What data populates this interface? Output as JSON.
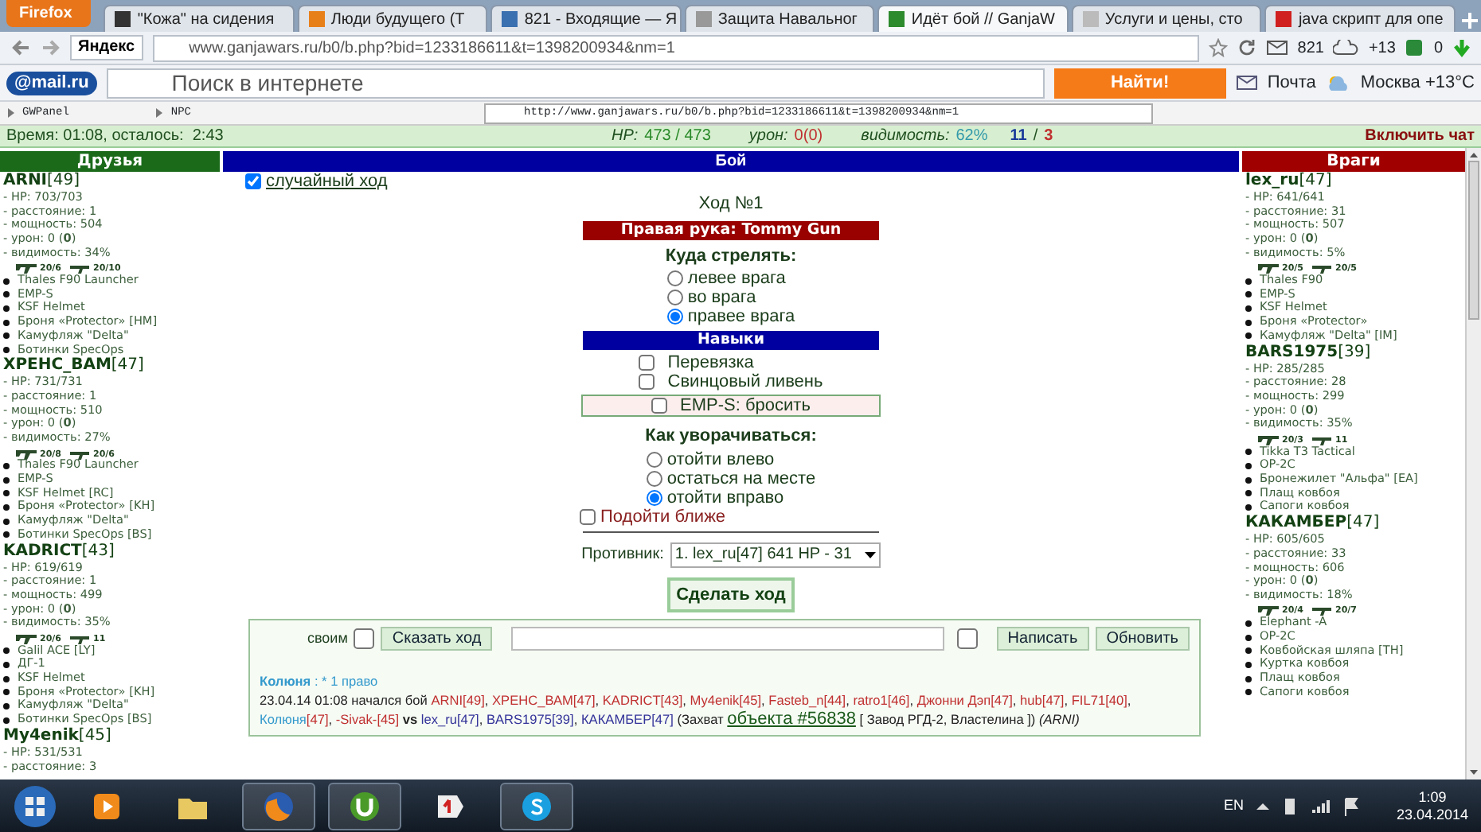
{
  "browser": {
    "menu_button": "Firefox",
    "tabs": [
      {
        "title": "\"Кожа\" на сидения",
        "selected": false,
        "color": "#333333"
      },
      {
        "title": "Люди будущего (Т",
        "selected": false,
        "color": "#e8801a"
      },
      {
        "title": "821 - Входящие — Я",
        "selected": false,
        "color": "#3a6fb0"
      },
      {
        "title": "Защита Навальног",
        "selected": false,
        "color": "#999999"
      },
      {
        "title": "Идёт бой // GanjaW",
        "selected": true,
        "color": "#2d8a2d"
      },
      {
        "title": "Услуги и цены, сто",
        "selected": false,
        "color": "#bbbbbb"
      },
      {
        "title": "java скрипт для опе",
        "selected": false,
        "color": "#d02020"
      }
    ],
    "search_engine": "Яндекс",
    "address": "www.ganjawars.ru/b0/b.php?bid=1233186611&t=1398200934&nm=1",
    "mail_count": "821",
    "weather_temp": "+13",
    "counter": "0"
  },
  "mailru_bar": {
    "logo": "@mail.ru",
    "placeholder": "Поиск в интернете",
    "search_button": "Найти!",
    "mail": "Почта",
    "weather": "Москва +13°C"
  },
  "ext_bar": {
    "items": [
      "GWPanel",
      "NPC"
    ],
    "url": "http://www.ganjawars.ru/b0/b.php?bid=1233186611&t=1398200934&nm=1"
  },
  "status": {
    "time": "Время: 01:08, осталось:  2:43",
    "hp_label": "HP:",
    "hp": "473 / 473",
    "damage_label": "урон:",
    "damage": "0(0)",
    "visibility_label": "видимость:",
    "visibility": "62%",
    "friends_count": "11",
    "separator": "/",
    "enemies_count": "3",
    "chat_button": "Включить чат"
  },
  "friends": {
    "title": "Друзья",
    "players": [
      {
        "name": "ARNI",
        "level": "[49]",
        "stats": [
          "- HP: 703/703",
          "- расстояние: 1",
          "- мощность: 504",
          "- урон: 0 (**0**)",
          "- видимость: 34%"
        ],
        "weapons": [
          "20/6",
          "20/10"
        ],
        "items": [
          "Thales F90 Launcher",
          "EMP-S",
          "KSF Helmet",
          "Броня «Protector» [HM]",
          "Камуфляж \"Delta\"",
          "Ботинки SpecOps"
        ]
      },
      {
        "name": "ХРЕНС_ВАМ",
        "level": "[47]",
        "stats": [
          "- HP: 731/731",
          "- расстояние: 1",
          "- мощность: 510",
          "- урон: 0 (**0**)",
          "- видимость: 27%"
        ],
        "weapons": [
          "20/8",
          "20/6"
        ],
        "items": [
          "Thales F90 Launcher",
          "EMP-S",
          "KSF Helmet [RC]",
          "Броня «Protector» [KH]",
          "Камуфляж \"Delta\"",
          "Ботинки SpecOps [BS]"
        ]
      },
      {
        "name": "KADRICT",
        "level": "[43]",
        "stats": [
          "- HP: 619/619",
          "- расстояние: 1",
          "- мощность: 499",
          "- урон: 0 (**0**)",
          "- видимость: 35%"
        ],
        "weapons": [
          "20/6",
          "11"
        ],
        "items": [
          "Galil ACE [LY]",
          "ДГ-1",
          "KSF Helmet",
          "Броня «Protector» [KH]",
          "Камуфляж \"Delta\"",
          "Ботинки SpecOps [BS]"
        ]
      },
      {
        "name": "My4enik",
        "level": "[45]",
        "stats": [
          "- HP: 531/531",
          "- расстояние: 3"
        ]
      }
    ]
  },
  "battle": {
    "title": "Бой",
    "random_move": {
      "label": "случайный ход",
      "checked": true
    },
    "turn": "Ход №1",
    "hand": "Правая рука: Tommy Gun",
    "shoot": {
      "title": "Куда стрелять:",
      "options": [
        {
          "label": "левее врага",
          "selected": false
        },
        {
          "label": "во врага",
          "selected": false
        },
        {
          "label": "правее врага",
          "selected": true
        }
      ]
    },
    "skills_title": "Навыки",
    "skills": [
      {
        "label": "Перевязка",
        "checked": false
      },
      {
        "label": "Свинцовый ливень",
        "checked": false
      }
    ],
    "emp": {
      "label": "EMP-S: бросить",
      "checked": false
    },
    "dodge": {
      "title": "Как уворачиваться:",
      "options": [
        {
          "label": "отойти влево",
          "selected": false
        },
        {
          "label": "остаться на месте",
          "selected": false
        },
        {
          "label": "отойти вправо",
          "selected": true
        }
      ]
    },
    "approach": {
      "label": "Подойти ближе",
      "checked": false
    },
    "opponent_label": "Противник:",
    "opponent": "1. lex_ru[47] 641 HP - 31",
    "submit": "Сделать ход",
    "chat": {
      "own_label": "своим",
      "own_checked": false,
      "say_button": "Сказать ход",
      "extra_checked": false,
      "write_button": "Написать",
      "refresh_button": "Обновить"
    },
    "log": [
      [
        {
          "kind": "author",
          "text": "Колюня",
          "color": "#3399cc"
        },
        {
          "kind": "text",
          "text": " : * 1 право",
          "color": "#3399cc"
        }
      ],
      [
        {
          "text": "23.04.14 01:08 начался бой "
        },
        {
          "text": "ARNI[49]",
          "color": "#c03030"
        },
        {
          "text": ", "
        },
        {
          "text": "ХРЕНС_ВАМ[47]",
          "color": "#c03030"
        },
        {
          "text": ", "
        },
        {
          "text": "KADRICT[43]",
          "color": "#c03030"
        },
        {
          "text": ", "
        },
        {
          "text": "My4enik[45]",
          "color": "#c03030"
        },
        {
          "text": ", "
        },
        {
          "text": "Fasteb_n[44]",
          "color": "#c03030"
        },
        {
          "text": ", "
        },
        {
          "text": "ratro1[46]",
          "color": "#c03030"
        },
        {
          "text": ", "
        },
        {
          "text": "Джонни Дэп[47]",
          "color": "#c03030"
        },
        {
          "text": ", "
        },
        {
          "text": "hub[47]",
          "color": "#c03030"
        },
        {
          "text": ", "
        },
        {
          "text": "FIL71[40]",
          "color": "#c03030"
        },
        {
          "text": ", "
        },
        {
          "text": "Колюня",
          "color": "#3399cc"
        },
        {
          "text": "[47]",
          "color": "#c03030"
        },
        {
          "text": ", "
        },
        {
          "text": "-Sivak-[45]",
          "color": "#c03030"
        },
        {
          "text": " **vs** "
        },
        {
          "text": "lex_ru[47]",
          "color": "#333399"
        },
        {
          "text": ", "
        },
        {
          "text": "BARS1975[39]",
          "color": "#333399"
        },
        {
          "text": ", "
        },
        {
          "text": "КАКАМБЕР[47]",
          "color": "#333399"
        },
        {
          "text": " (Захват "
        },
        {
          "kind": "link",
          "text": "объекта #56838"
        },
        {
          "text": " [ Завод РГД-2, Властелина ]) *(ARNI)*"
        }
      ]
    ]
  },
  "enemies": {
    "title": "Враги",
    "players": [
      {
        "name": "lex_ru",
        "level": "[47]",
        "stats": [
          "- HP: 641/641",
          "- расстояние: 31",
          "- мощность: 507",
          "- урон: 0 (**0**)",
          "- видимость: 5%"
        ],
        "weapons": [
          "20/5",
          "20/5"
        ],
        "items": [
          "Thales F90",
          "EMP-S",
          "KSF Helmet",
          "Броня «Protector»",
          "Камуфляж \"Delta\" [IM]"
        ]
      },
      {
        "name": "BARS1975",
        "level": "[39]",
        "stats": [
          "- HP: 285/285",
          "- расстояние: 28",
          "- мощность: 299",
          "- урон: 0 (**0**)",
          "- видимость: 35%"
        ],
        "weapons": [
          "20/3",
          "11"
        ],
        "items": [
          "Tikka T3 Tactical",
          "OP-2C",
          "Бронежилет \"Альфа\" [EA]",
          "Плащ ковбоя",
          "Сапоги ковбоя"
        ]
      },
      {
        "name": "КАКАМБЕР",
        "level": "[47]",
        "stats": [
          "- HP: 605/605",
          "- расстояние: 33",
          "- мощность: 606",
          "- урон: 0 (**0**)",
          "- видимость: 18%"
        ],
        "weapons": [
          "20/4",
          "20/7"
        ],
        "items": [
          "Elephant -A",
          "OP-2C",
          "Ковбойская шляпа [TH]",
          "Куртка ковбоя",
          "Плащ ковбоя",
          "Сапоги ковбоя"
        ]
      }
    ]
  },
  "taskbar": {
    "apps": [
      {
        "kind": "media",
        "running": false
      },
      {
        "kind": "folder",
        "running": false
      },
      {
        "kind": "browser",
        "running": true
      },
      {
        "kind": "torrent",
        "running": true
      },
      {
        "kind": "yandex",
        "running": false
      },
      {
        "kind": "skype",
        "running": true
      }
    ],
    "language": "EN",
    "time": "1:09",
    "date": "23.04.2014"
  }
}
